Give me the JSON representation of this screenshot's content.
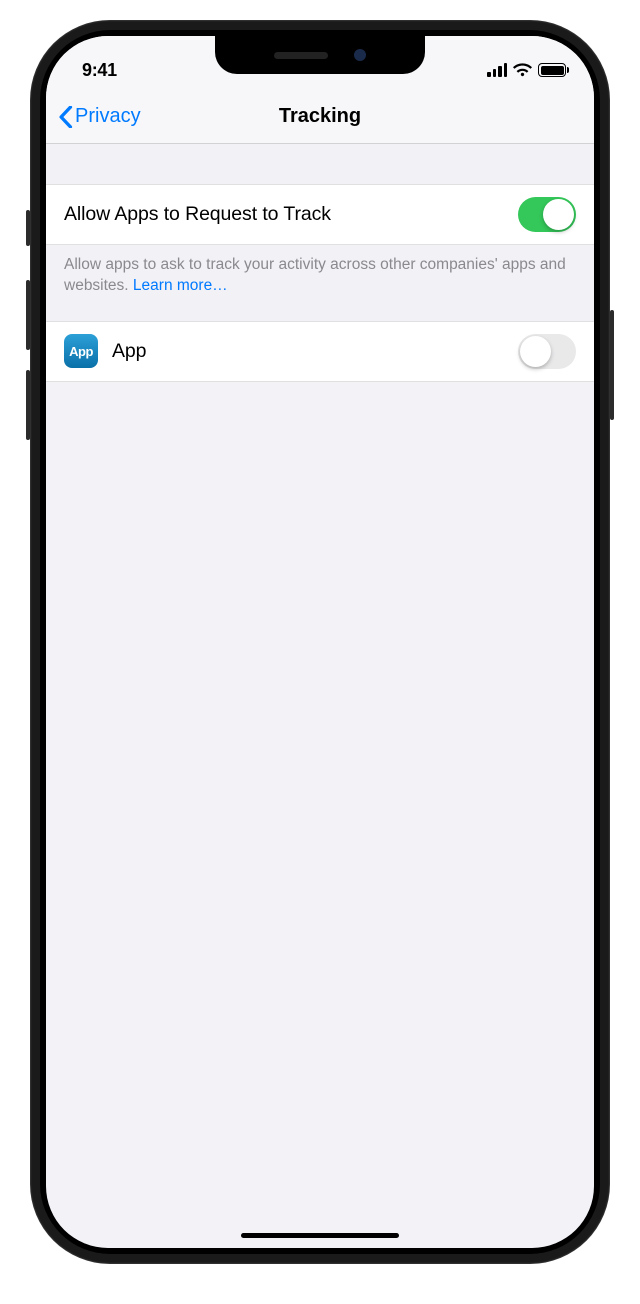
{
  "statusbar": {
    "time": "9:41"
  },
  "nav": {
    "back_label": "Privacy",
    "title": "Tracking"
  },
  "rows": {
    "allow": {
      "label": "Allow Apps to Request to Track",
      "on": true
    },
    "app": {
      "label": "App",
      "icon_text": "App",
      "on": false
    }
  },
  "footer": {
    "text": "Allow apps to ask to track your activity across other companies' apps and websites. ",
    "link": "Learn more…"
  }
}
